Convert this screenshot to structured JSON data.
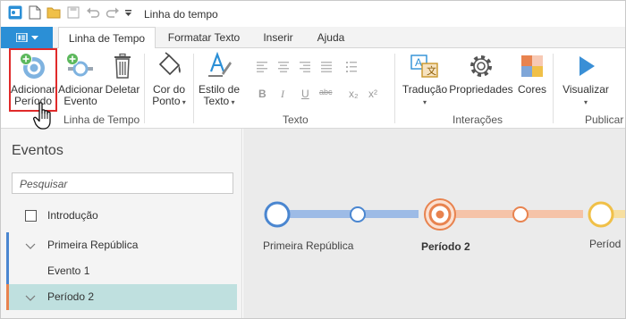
{
  "window": {
    "title": "Linha do tempo"
  },
  "colors": {
    "accent": "#2b8fd6",
    "highlight": "#e02a2a",
    "blue_period": "#4a86d0",
    "orange_period": "#e8834f",
    "yellow_period": "#f0c048",
    "selected_row": "#bfe0df"
  },
  "tabs": [
    {
      "label": "Linha de Tempo",
      "active": true
    },
    {
      "label": "Formatar Texto",
      "active": false
    },
    {
      "label": "Inserir",
      "active": false
    },
    {
      "label": "Ajuda",
      "active": false
    }
  ],
  "ribbon": {
    "add_period": {
      "line1": "Adicionar",
      "line2": "Período"
    },
    "add_event": {
      "line1": "Adicionar",
      "line2": "Evento"
    },
    "delete": {
      "label": "Deletar"
    },
    "point_color": {
      "line1": "Cor do",
      "line2": "Ponto"
    },
    "text_style": {
      "line1": "Estilo de",
      "line2": "Texto"
    },
    "translate": {
      "label": "Tradução"
    },
    "properties": {
      "label": "Propriedades"
    },
    "colors": {
      "label": "Cores"
    },
    "view": {
      "label": "Visualizar"
    },
    "groups": {
      "timeline": "Linha de Tempo",
      "text": "Texto",
      "interactions": "Interações",
      "publish": "Publicar"
    },
    "text_format_icons": [
      "bold-icon",
      "italic-icon",
      "underline-icon",
      "strikethrough-icon",
      "subscript-icon",
      "superscript-icon"
    ],
    "text_glyphs": {
      "bold": "B",
      "italic": "I",
      "underline": "U",
      "strike": "abc",
      "subscript": "x₂",
      "superscript": "x²"
    }
  },
  "events_panel": {
    "title": "Eventos",
    "search_placeholder": "Pesquisar",
    "items": [
      {
        "label": "Introdução",
        "kind": "checkbox"
      },
      {
        "label": "Primeira República",
        "kind": "period",
        "color": "#4a86d0"
      },
      {
        "label": "Evento 1",
        "kind": "event"
      },
      {
        "label": "Período 2",
        "kind": "period",
        "color": "#e8834f",
        "selected": true
      }
    ]
  },
  "timeline": {
    "labels": {
      "p1": "Primeira República",
      "p2": "Período 2",
      "p3": "Períod"
    }
  }
}
